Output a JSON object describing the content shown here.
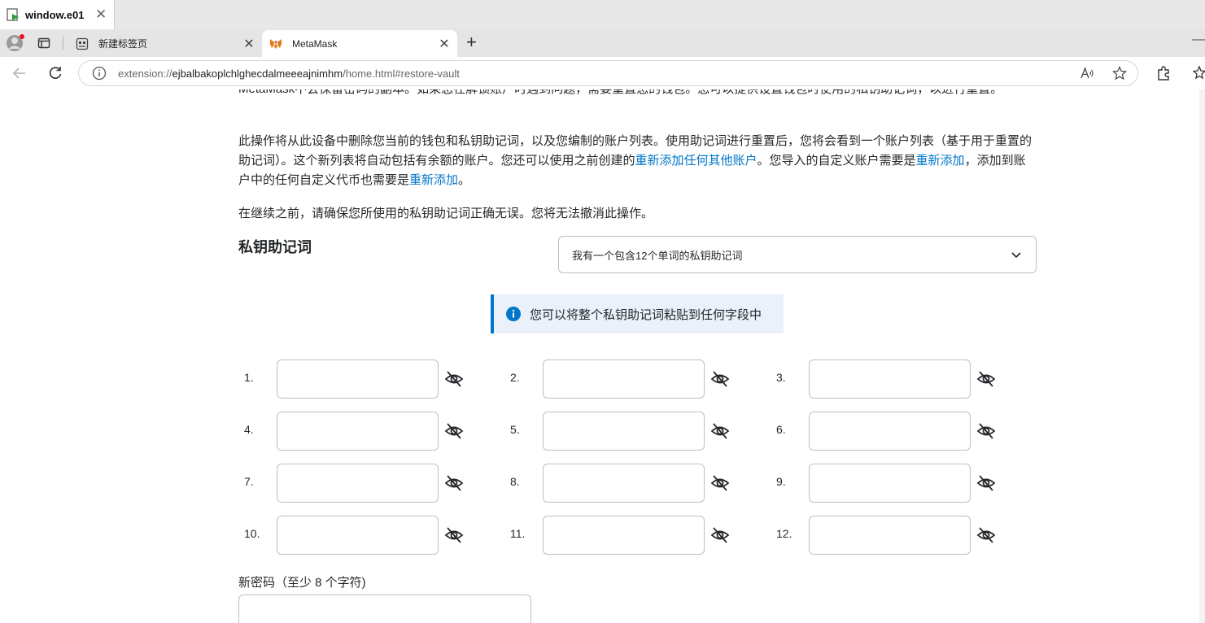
{
  "os_window": {
    "title": "window.e01",
    "close_glyph": "✕"
  },
  "tabs": [
    {
      "label": "新建标签页",
      "icon": "new-tab-page-icon",
      "close_glyph": "✕"
    },
    {
      "label": "MetaMask",
      "icon": "metamask-fox-icon",
      "close_glyph": "✕",
      "active": true
    }
  ],
  "new_tab_glyph": "+",
  "window_minimize_glyph": "—",
  "address_bar": {
    "scheme": "extension://",
    "host": "ejbalbakoplchlghecdalmeeeajnimhm",
    "path": "/home.html#restore-vault"
  },
  "page": {
    "intro_tail": "MetaMask不会保留密码的副本。如果您在解锁账户时遇到问题，需要重置您的钱包。您可以提供设置钱包时使用的私钥助记词，以进行重置。",
    "para2_part1": "此操作将从此设备中删除您当前的钱包和私钥助记词，以及您编制的账户列表。使用助记词进行重置后，您将会看到一个账户列表（基于用于重置的助记词）。这个新列表将自动包括有余额的账户。您还可以使用之前创建的",
    "para2_link1": "重新添加任何其他账户",
    "para2_part2": "。您导入的自定义账户需要是",
    "para2_link2": "重新添加",
    "para2_part3": "，添加到账户中的任何自定义代币也需要是",
    "para2_link3": "重新添加",
    "para2_part4": "。",
    "para3": "在继续之前，请确保您所使用的私钥助记词正确无误。您将无法撤消此操作。",
    "srp_label": "私钥助记词",
    "srp_dropdown_value": "我有一个包含12个单词的私钥助记词",
    "paste_hint": "您可以将整个私钥助记词粘贴到任何字段中",
    "word_numbers": [
      "1.",
      "2.",
      "3.",
      "4.",
      "5.",
      "6.",
      "7.",
      "8.",
      "9.",
      "10.",
      "11.",
      "12."
    ],
    "new_password_label": "新密码（至少 8 个字符)"
  },
  "colors": {
    "link": "#0376c9",
    "info_banner_bg": "#eaf1fa",
    "info_accent": "#0376c9"
  }
}
